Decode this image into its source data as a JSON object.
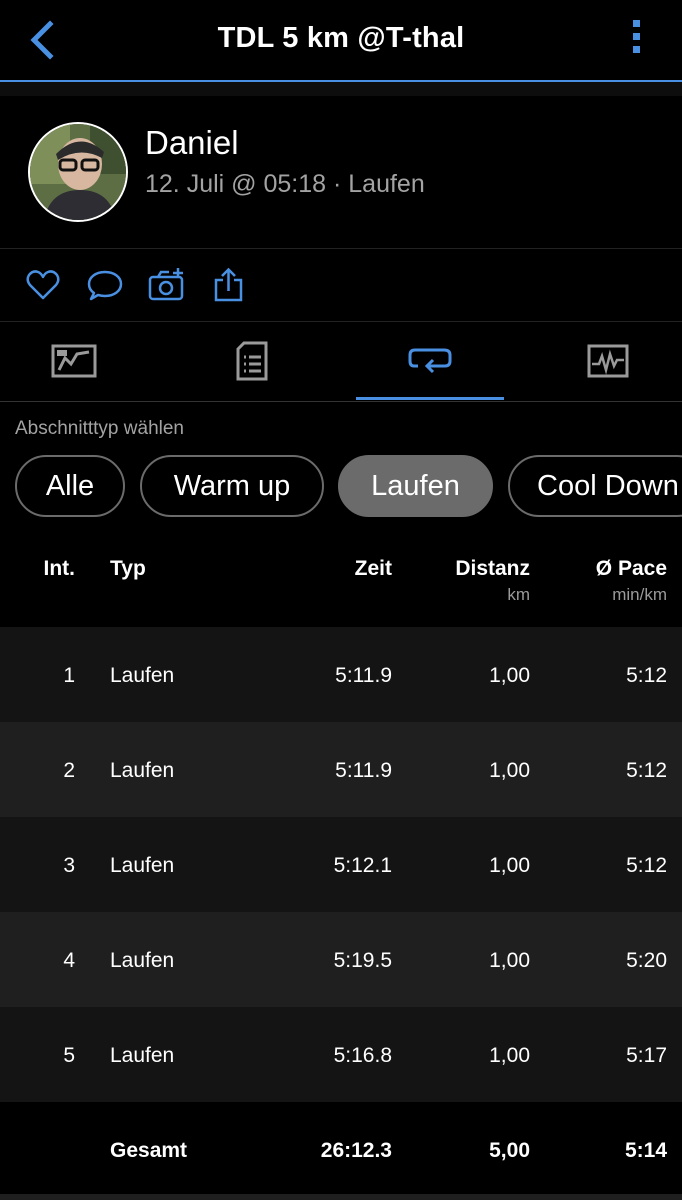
{
  "header": {
    "title": "TDL 5 km @T-thal",
    "accent": "#4a90e2"
  },
  "profile": {
    "name": "Daniel",
    "meta": "12. Juli @ 05:18 · Laufen"
  },
  "actions": [
    "heart-icon",
    "comment-icon",
    "add-photo-icon",
    "share-icon"
  ],
  "tabs": [
    "map-tab",
    "details-tab",
    "laps-tab",
    "stats-tab"
  ],
  "active_tab": "laps-tab",
  "filter": {
    "label": "Abschnitttyp wählen",
    "chips": [
      "Alle",
      "Warm up",
      "Laufen",
      "Cool Down"
    ],
    "selected": "Laufen"
  },
  "table": {
    "headers": {
      "int": "Int.",
      "typ": "Typ",
      "zeit": "Zeit",
      "distanz": "Distanz",
      "distanz_unit": "km",
      "pace": "Ø Pace",
      "pace_unit": "min/km"
    },
    "rows": [
      {
        "int": "1",
        "typ": "Laufen",
        "zeit": "5:11.9",
        "distanz": "1,00",
        "pace": "5:12"
      },
      {
        "int": "2",
        "typ": "Laufen",
        "zeit": "5:11.9",
        "distanz": "1,00",
        "pace": "5:12"
      },
      {
        "int": "3",
        "typ": "Laufen",
        "zeit": "5:12.1",
        "distanz": "1,00",
        "pace": "5:12"
      },
      {
        "int": "4",
        "typ": "Laufen",
        "zeit": "5:19.5",
        "distanz": "1,00",
        "pace": "5:20"
      },
      {
        "int": "5",
        "typ": "Laufen",
        "zeit": "5:16.8",
        "distanz": "1,00",
        "pace": "5:17"
      }
    ],
    "total": {
      "typ": "Gesamt",
      "zeit": "26:12.3",
      "distanz": "5,00",
      "pace": "5:14"
    }
  }
}
